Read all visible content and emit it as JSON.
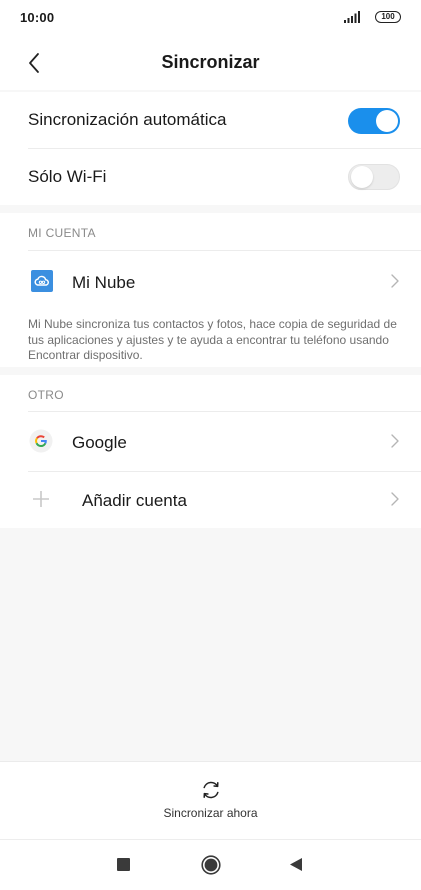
{
  "status_bar": {
    "time": "10:00",
    "battery": "100"
  },
  "header": {
    "title": "Sincronizar",
    "back_icon": "chevron-left-icon"
  },
  "settings": {
    "auto_sync": {
      "label": "Sincronización automática",
      "enabled": true
    },
    "wifi_only": {
      "label": "Sólo Wi-Fi",
      "enabled": false
    }
  },
  "my_account": {
    "section_title": "MI CUENTA",
    "item": {
      "label": "Mi Nube",
      "icon": "cloud-icon"
    },
    "description": "Mi Nube sincroniza tus contactos y fotos, hace copia de seguridad de tus aplicaciones y ajustes y te ayuda a encontrar tu teléfono usando Encontrar dispositivo."
  },
  "other": {
    "section_title": "OTRO",
    "items": [
      {
        "label": "Google",
        "icon": "google-icon"
      },
      {
        "label": "Añadir cuenta",
        "icon": "plus-icon"
      }
    ]
  },
  "bottom_action": {
    "label": "Sincronizar ahora",
    "icon": "sync-icon"
  },
  "colors": {
    "accent": "#1a8fec",
    "background": "#f7f7f7",
    "mi_cloud": "#3b8fe0"
  }
}
